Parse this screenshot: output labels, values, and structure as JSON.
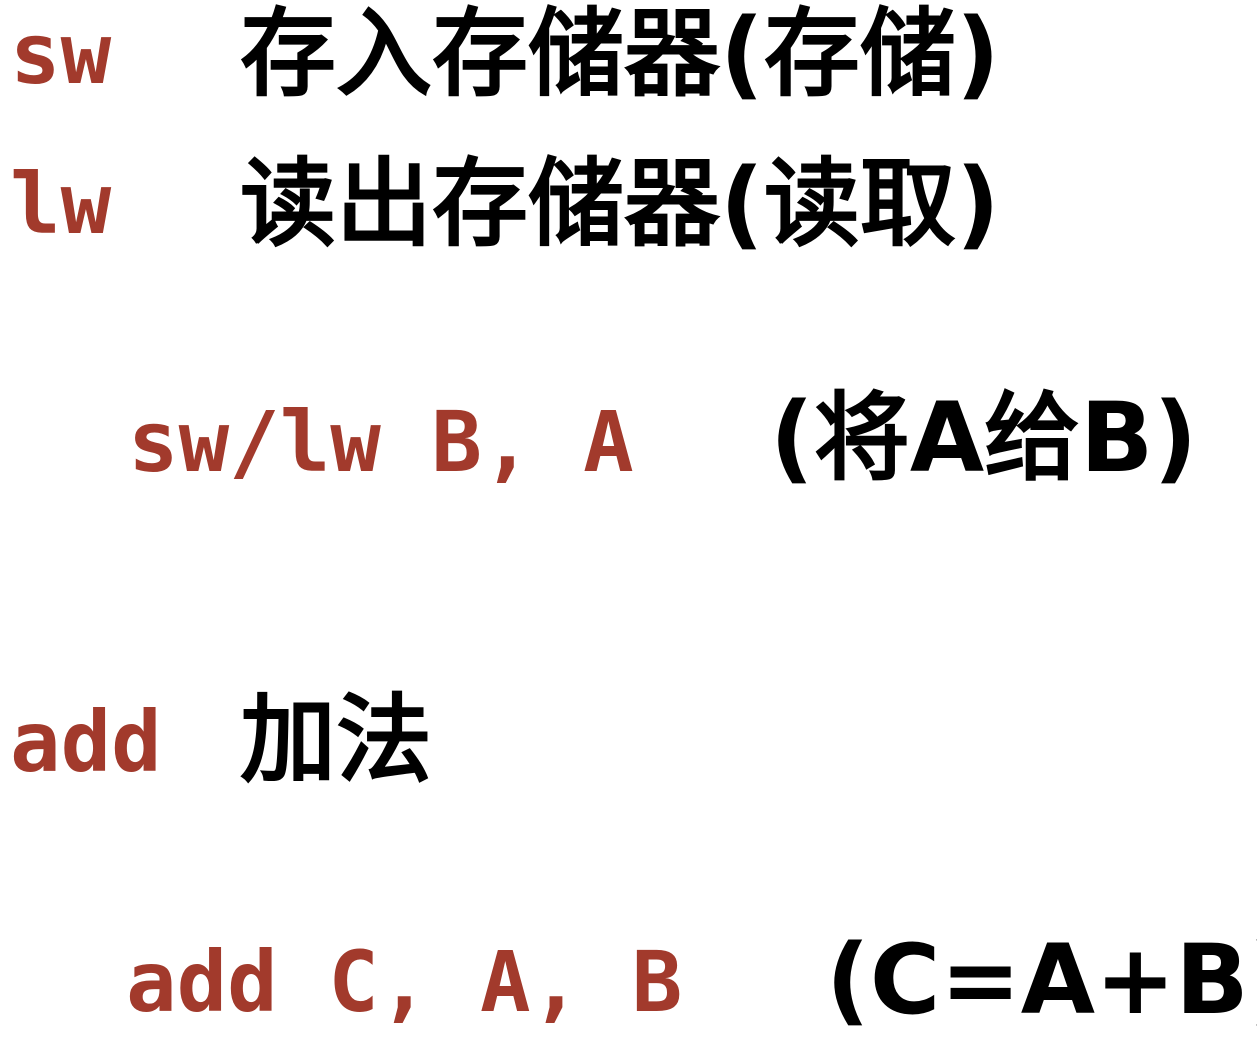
{
  "lines": [
    {
      "code": "sw",
      "desc": "存入存储器(存储)"
    },
    {
      "code": "lw",
      "desc": "读出存储器(读取)"
    },
    {
      "code": "sw/lw B, A",
      "desc": "(将A给B)"
    },
    {
      "code": "add",
      "desc": "加法"
    },
    {
      "code": "add C, A, B",
      "desc": "(C=A+B)"
    }
  ],
  "colors": {
    "code": "#a23a2c",
    "text": "#000000",
    "background": "#ffffff"
  }
}
